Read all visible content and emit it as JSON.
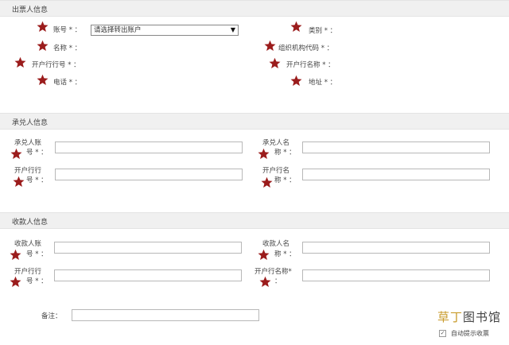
{
  "drawer": {
    "title": "出票人信息",
    "account_label": "账号",
    "account_select": "请选择转出账户",
    "name_label": "名称",
    "bank_no_label": "开户行行号",
    "phone_label": "电话",
    "category_label": "类别",
    "org_code_label": "组织机构代码",
    "bank_name_label": "开户行名称",
    "address_label": "地址"
  },
  "acceptor": {
    "title": "承兑人信息",
    "account_label_1": "承兑人账",
    "account_label_2": "号",
    "name_label_1": "承兑人名",
    "name_label_2": "称",
    "bank_no_label_1": "开户行行",
    "bank_no_label_2": "号",
    "bank_name_label_1": "开户行名",
    "bank_name_label_2": "称"
  },
  "payee": {
    "title": "收款人信息",
    "account_label_1": "收款人账",
    "account_label_2": "号",
    "name_label_1": "收款人名",
    "name_label_2": "称",
    "bank_no_label_1": "开户行行",
    "bank_no_label_2": "号",
    "bank_name_label": "开户行名称"
  },
  "remark_label": "备注",
  "auto_prompt_label": "自动提示收票",
  "watermark": {
    "part1": "草丁",
    "part2": "图书馆"
  },
  "colors": {
    "star": "#9b1c1c",
    "section_bg": "#f0f0f0"
  }
}
